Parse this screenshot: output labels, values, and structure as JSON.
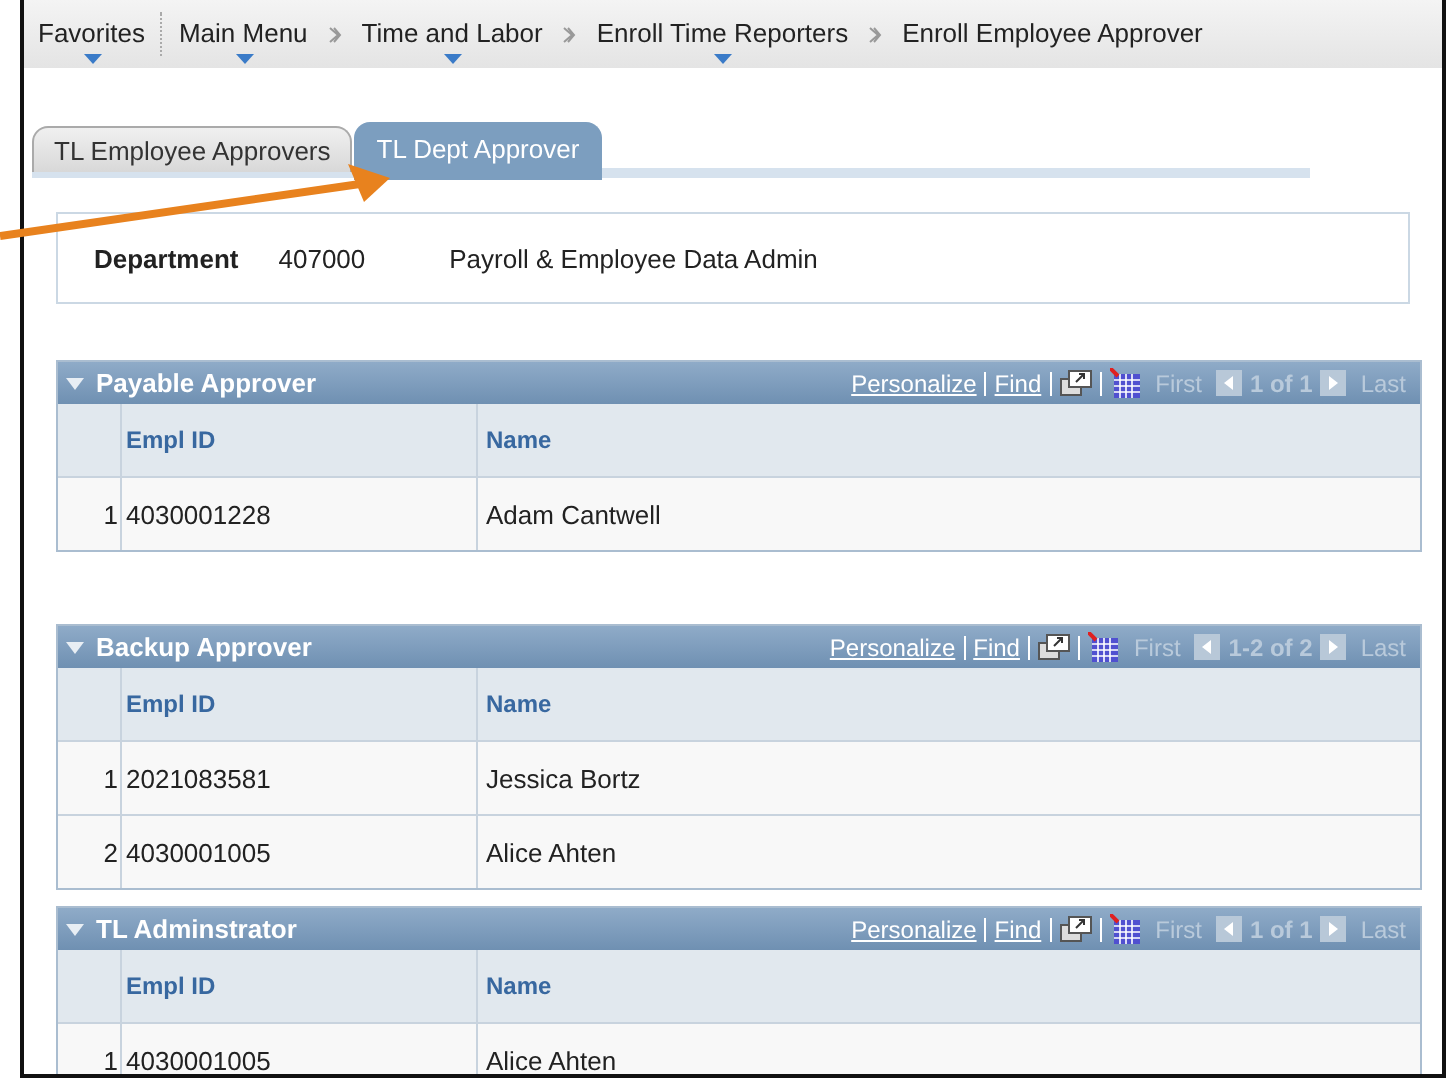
{
  "breadcrumbs": [
    {
      "label": "Favorites",
      "dropdown": true
    },
    {
      "label": "Main Menu",
      "dropdown": true
    },
    {
      "label": "Time and Labor",
      "dropdown": true
    },
    {
      "label": "Enroll Time Reporters",
      "dropdown": true
    },
    {
      "label": "Enroll Employee Approver",
      "dropdown": false
    }
  ],
  "tabs": [
    {
      "label": "TL Employee Approvers",
      "selected": false
    },
    {
      "label": "TL Dept Approver",
      "selected": true
    }
  ],
  "department": {
    "label": "Department",
    "code": "407000",
    "description": "Payroll & Employee Data Admin"
  },
  "grids": [
    {
      "title": "Payable Approver",
      "personalize": "Personalize",
      "find": "Find",
      "first": "First",
      "range": "1 of 1",
      "last": "Last",
      "columns": [
        "Empl ID",
        "Name"
      ],
      "rows": [
        {
          "num": "1",
          "empl_id": "4030001228",
          "name": "Adam Cantwell"
        }
      ]
    },
    {
      "title": "Backup Approver",
      "personalize": "Personalize",
      "find": "Find",
      "first": "First",
      "range": "1-2 of 2",
      "last": "Last",
      "columns": [
        "Empl ID",
        "Name"
      ],
      "rows": [
        {
          "num": "1",
          "empl_id": "2021083581",
          "name": "Jessica Bortz"
        },
        {
          "num": "2",
          "empl_id": "4030001005",
          "name": "Alice Ahten"
        }
      ]
    },
    {
      "title": "TL Adminstrator",
      "personalize": "Personalize",
      "find": "Find",
      "first": "First",
      "range": "1 of 1",
      "last": "Last",
      "columns": [
        "Empl ID",
        "Name"
      ],
      "rows": [
        {
          "num": "1",
          "empl_id": "4030001005",
          "name": "Alice Ahten"
        }
      ]
    }
  ]
}
